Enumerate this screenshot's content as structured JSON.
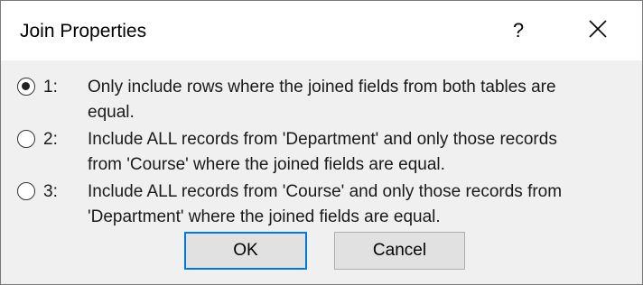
{
  "dialog": {
    "title": "Join Properties",
    "help_label": "?",
    "close_icon": "close-icon"
  },
  "options": [
    {
      "number": "1:",
      "text": "Only include rows where the joined fields from both tables are\nequal.",
      "selected": true
    },
    {
      "number": "2:",
      "text": "Include ALL records from 'Department' and only those records\nfrom 'Course' where the joined fields are equal.",
      "selected": false
    },
    {
      "number": "3:",
      "text": "Include ALL records from 'Course' and only those records from\n'Department' where the joined fields are equal.",
      "selected": false
    }
  ],
  "buttons": {
    "ok_label": "OK",
    "cancel_label": "Cancel"
  },
  "colors": {
    "default_button_border": "#0078d7",
    "titlebar_background": "#ffffff",
    "body_background": "#f0f0f0"
  }
}
